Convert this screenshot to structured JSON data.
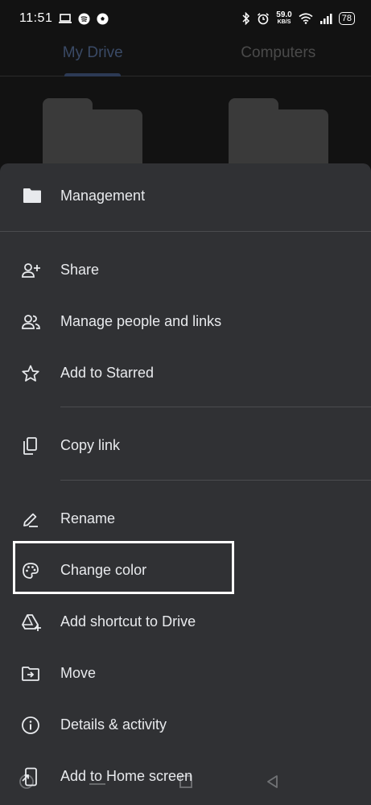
{
  "status_bar": {
    "time": "11:51",
    "speed_value": "59.0",
    "speed_unit": "KB/S",
    "battery": "78"
  },
  "tabs": [
    {
      "label": "My Drive",
      "active": true
    },
    {
      "label": "Computers",
      "active": false
    }
  ],
  "sheet": {
    "title": "Management",
    "title_icon": "folder-icon",
    "items": [
      {
        "label": "Share",
        "icon": "person-add-icon"
      },
      {
        "label": "Manage people and links",
        "icon": "people-icon"
      },
      {
        "label": "Add to Starred",
        "icon": "star-icon"
      },
      {
        "label": "Copy link",
        "icon": "copy-icon"
      },
      {
        "label": "Rename",
        "icon": "pencil-icon"
      },
      {
        "label": "Change color",
        "icon": "palette-icon",
        "highlighted": true
      },
      {
        "label": "Add shortcut to Drive",
        "icon": "drive-shortcut-icon"
      },
      {
        "label": "Move",
        "icon": "move-folder-icon"
      },
      {
        "label": "Details & activity",
        "icon": "info-icon"
      },
      {
        "label": "Add to Home screen",
        "icon": "home-screen-icon"
      }
    ]
  },
  "colors": {
    "sheet_bg": "#303134",
    "text": "#e8eaed",
    "highlight": "#ffffff"
  }
}
